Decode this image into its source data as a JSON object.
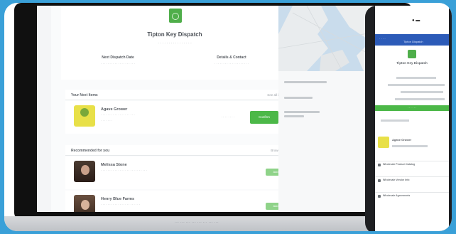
{
  "laptop": {
    "caption": "··· ··· ··· ··· ··· ··· ··· ···"
  },
  "profile": {
    "title": "Tipton Key Dispatch",
    "subtitle": "· · · · · · · · · · · · · · · ·",
    "left_col_heading": "Next Dispatch Date",
    "left_col_text": "· · · · · · · · · · · · · · · · · · · ·",
    "right_col_heading": "Details & Contact",
    "right_col_text": "· · · · · · · · · · · · · · · · · · · ·"
  },
  "section_main": {
    "heading": "Your Next Items",
    "link": "See all items"
  },
  "featured_item": {
    "name": "Agave Grower",
    "desc": "· · · · · · · · · · · · · · · · · · · ·",
    "meta": "· · · · · · ·",
    "status": "· · · · · · · ·",
    "button": "Confirm"
  },
  "section_secondary": {
    "heading": "Recommended for you",
    "link": "Browse all"
  },
  "list_items": [
    {
      "name": "Melissa Stone",
      "desc": "· · · · · · · · · · · · · · · · · · · · · · · · · · ·",
      "meta": "",
      "button": "Add"
    },
    {
      "name": "Henry Blue Farms",
      "desc": "· · · · · · · · · · · · · · · · · · · · · · ·",
      "meta": "",
      "button": "Add"
    }
  ],
  "sidebar": {
    "label_1": "· · · · · · · · ·",
    "label_2": "· · · · · ·"
  },
  "phone": {
    "header_left": "· · · ·",
    "header_center": "Tipton Dispatch",
    "title": "Tipton Key Dispatch",
    "button": "· · · · · ·",
    "item_name": "Agave Grower",
    "list": [
      "Wholesale Product Catalog",
      "Wholesale Vendor Info",
      "Wholesale Agreements"
    ]
  },
  "colors": {
    "brand_green": "#4cb848",
    "header_blue": "#2c5bb8",
    "background_blue": "#3aa0d8"
  }
}
